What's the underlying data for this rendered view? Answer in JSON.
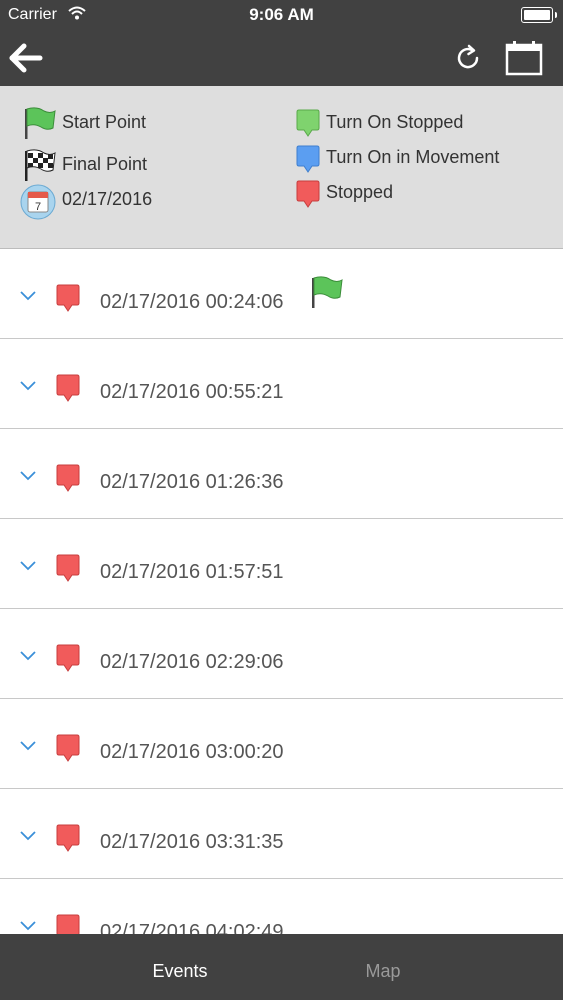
{
  "status_bar": {
    "carrier": "Carrier",
    "time": "9:06 AM"
  },
  "legend": {
    "start_point": "Start Point",
    "final_point": "Final Point",
    "date": "02/17/2016",
    "calendar_day": "7",
    "turn_on_stopped": "Turn On Stopped",
    "turn_on_in_movement": "Turn On in Movement",
    "stopped": "Stopped"
  },
  "colors": {
    "bar": "#414141",
    "stopped": "#f15b5b",
    "turn_on_stopped": "#7fd36e",
    "turn_on_in_movement": "#5b9ef1",
    "start_flag": "#5cc45a",
    "chevron": "#3a8fd8"
  },
  "events": [
    {
      "timestamp": "02/17/2016 00:24:06",
      "marker": "stopped",
      "start_flag": true
    },
    {
      "timestamp": "02/17/2016 00:55:21",
      "marker": "stopped",
      "start_flag": false
    },
    {
      "timestamp": "02/17/2016 01:26:36",
      "marker": "stopped",
      "start_flag": false
    },
    {
      "timestamp": "02/17/2016 01:57:51",
      "marker": "stopped",
      "start_flag": false
    },
    {
      "timestamp": "02/17/2016 02:29:06",
      "marker": "stopped",
      "start_flag": false
    },
    {
      "timestamp": "02/17/2016 03:00:20",
      "marker": "stopped",
      "start_flag": false
    },
    {
      "timestamp": "02/17/2016 03:31:35",
      "marker": "stopped",
      "start_flag": false
    },
    {
      "timestamp": "02/17/2016 04:02:49",
      "marker": "stopped",
      "start_flag": false
    }
  ],
  "tabs": [
    {
      "label": "Events",
      "selected": true
    },
    {
      "label": "Map",
      "selected": false
    }
  ]
}
